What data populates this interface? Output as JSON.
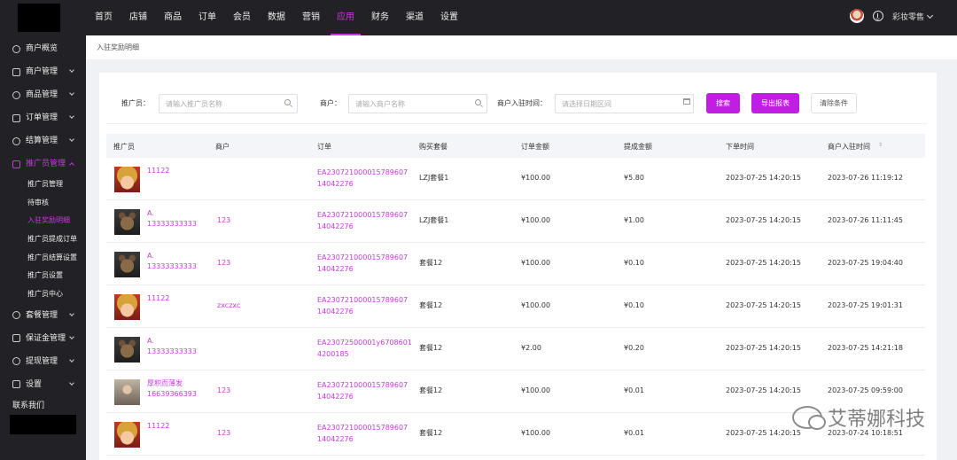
{
  "topnav": {
    "items": [
      "首页",
      "店铺",
      "商品",
      "订单",
      "会员",
      "数据",
      "营销",
      "应用",
      "财务",
      "渠道",
      "设置"
    ],
    "active_index": 7,
    "user_name": "彩妆零售"
  },
  "sidebar": {
    "items": [
      {
        "label": "商户概览",
        "icon": "gear-icon",
        "arrow": false
      },
      {
        "label": "商户管理",
        "icon": "store-icon",
        "arrow": true
      },
      {
        "label": "商品管理",
        "icon": "goods-icon",
        "arrow": true
      },
      {
        "label": "订单管理",
        "icon": "order-icon",
        "arrow": true
      },
      {
        "label": "结算管理",
        "icon": "settle-icon",
        "arrow": true
      },
      {
        "label": "推广员管理",
        "icon": "user-icon",
        "arrow": true,
        "open": true
      }
    ],
    "sub_items": [
      "推广员管理",
      "待审核",
      "入驻奖励明细",
      "推广员提成订单",
      "推广员结算设置",
      "推广员设置",
      "推广员中心"
    ],
    "active_sub_index": 2,
    "items_after": [
      {
        "label": "套餐管理",
        "icon": "package-icon",
        "arrow": true
      },
      {
        "label": "保证金管理",
        "icon": "deposit-icon",
        "arrow": true
      },
      {
        "label": "提现管理",
        "icon": "withdraw-icon",
        "arrow": true
      },
      {
        "label": "设置",
        "icon": "settings-icon",
        "arrow": true
      }
    ],
    "contact_label": "联系我们"
  },
  "breadcrumb": "入驻奖励明细",
  "filters": {
    "promoter_label": "推广员：",
    "promoter_placeholder": "请输入推广员名称",
    "merchant_label": "商户：",
    "merchant_placeholder": "请输入商户名称",
    "join_time_label": "商户入驻时间：",
    "join_time_placeholder": "请选择日期区间",
    "search_label": "搜索",
    "export_label": "导出报表",
    "clear_label": "清除条件"
  },
  "table": {
    "columns": [
      "推广员",
      "商户",
      "订单",
      "购买套餐",
      "订单金额",
      "提成金额",
      "下单时间",
      "商户入驻时间"
    ],
    "rows": [
      {
        "avatar": "luffy",
        "promoter": "11122",
        "promoter2": "",
        "merchant": "",
        "order1": "EA230721000015789607",
        "order2": "14042276",
        "package": "LZJ套餐1",
        "amount": "¥100.00",
        "commission": "¥5.80",
        "order_time": "2023-07-25 14:20:15",
        "join_time": "2023-07-26 11:19:12"
      },
      {
        "avatar": "bear",
        "promoter": "A.",
        "promoter2": "13333333333",
        "merchant": "123",
        "order1": "EA230721000015789607",
        "order2": "14042276",
        "package": "LZJ套餐1",
        "amount": "¥100.00",
        "commission": "¥1.00",
        "order_time": "2023-07-25 14:20:15",
        "join_time": "2023-07-26 11:11:45"
      },
      {
        "avatar": "bear",
        "promoter": "A.",
        "promoter2": "13333333333",
        "merchant": "123",
        "order1": "EA230721000015789607",
        "order2": "14042276",
        "package": "套餐12",
        "amount": "¥100.00",
        "commission": "¥0.10",
        "order_time": "2023-07-25 14:20:15",
        "join_time": "2023-07-25 19:04:40"
      },
      {
        "avatar": "luffy",
        "promoter": "11122",
        "promoter2": "",
        "merchant": "zxczxc",
        "order1": "EA230721000015789607",
        "order2": "14042276",
        "package": "套餐12",
        "amount": "¥100.00",
        "commission": "¥0.10",
        "order_time": "2023-07-25 14:20:15",
        "join_time": "2023-07-25 19:01:31"
      },
      {
        "avatar": "bear",
        "promoter": "A.",
        "promoter2": "13333333333",
        "merchant": "",
        "order1": "EA23072500001y6708601",
        "order2": "4200185",
        "package": "套餐12",
        "amount": "¥2.00",
        "commission": "¥0.20",
        "order_time": "2023-07-25 14:20:15",
        "join_time": "2023-07-25 14:21:18"
      },
      {
        "avatar": "person",
        "promoter": "厚积而薄发",
        "promoter2": "16639366393",
        "merchant": "123",
        "order1": "EA230721000015789607",
        "order2": "14042276",
        "package": "套餐12",
        "amount": "¥100.00",
        "commission": "¥0.01",
        "order_time": "2023-07-25 14:20:15",
        "join_time": "2023-07-25 09:59:00"
      },
      {
        "avatar": "luffy",
        "promoter": "11122",
        "promoter2": "",
        "merchant": "123",
        "order1": "EA230721000015789607",
        "order2": "14042276",
        "package": "套餐12",
        "amount": "¥100.00",
        "commission": "¥0.01",
        "order_time": "2023-07-25 14:20:15",
        "join_time": "2023-07-24 10:18:51"
      }
    ]
  },
  "watermark": "艾蒂娜科技",
  "colors": {
    "accent": "#c53bdc",
    "primary_button": "#c01ee0",
    "dark_bg": "#222226"
  }
}
